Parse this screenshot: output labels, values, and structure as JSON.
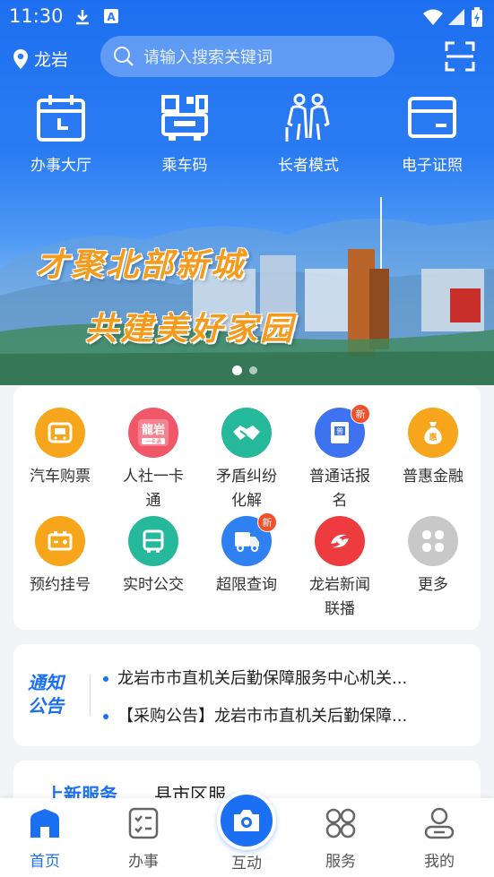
{
  "status_bar": {
    "time": "11:30"
  },
  "header": {
    "location": "龙岩",
    "search_placeholder": "请输入搜索关键词"
  },
  "quick_actions": [
    {
      "label": "办事大厅",
      "icon": "calendar-icon"
    },
    {
      "label": "乘车码",
      "icon": "bus-qr-icon"
    },
    {
      "label": "长者模式",
      "icon": "elderly-icon"
    },
    {
      "label": "电子证照",
      "icon": "card-icon"
    }
  ],
  "banner": {
    "line1": "才聚北部新城",
    "line2": "共建美好家园",
    "active_slide": 1,
    "slide_count": 2
  },
  "services": [
    {
      "label": "汽车购票",
      "color": "#f7a51a",
      "icon": "bus-ticket-icon"
    },
    {
      "label": "人社一卡通",
      "color": "#f0586a",
      "icon": "social-card-icon"
    },
    {
      "label": "矛盾纠纷化解",
      "color": "#25b89a",
      "icon": "handshake-icon"
    },
    {
      "label": "普通话报名",
      "color": "#3d73f0",
      "icon": "mandarin-book-icon",
      "badge": "新"
    },
    {
      "label": "普惠金融",
      "color": "#f7a51a",
      "icon": "money-bag-icon"
    },
    {
      "label": "预约挂号",
      "color": "#f7a51a",
      "icon": "battery-icon"
    },
    {
      "label": "实时公交",
      "color": "#25b89a",
      "icon": "bus-icon"
    },
    {
      "label": "超限查询",
      "color": "#2f80f0",
      "icon": "truck-icon",
      "badge": "新"
    },
    {
      "label": "龙岩新闻联播",
      "color": "#ee3b3f",
      "icon": "news-logo-icon"
    },
    {
      "label": "更多",
      "color": "#c8c8c8",
      "icon": "grid-icon"
    }
  ],
  "notice": {
    "logo_line1": "通知",
    "logo_line2": "公告",
    "items": [
      "龙岩市市直机关后勤保障服务中心机关...",
      "【采购公告】龙岩市市直机关后勤保障..."
    ]
  },
  "new_services": {
    "tab_active": "上新服务",
    "tab_other": "县市区服..."
  },
  "bottom_nav": [
    {
      "label": "首页",
      "icon": "home-icon",
      "active": true
    },
    {
      "label": "办事",
      "icon": "checklist-icon"
    },
    {
      "label": "互动",
      "icon": "camera-icon"
    },
    {
      "label": "服务",
      "icon": "services-grid-icon"
    },
    {
      "label": "我的",
      "icon": "profile-icon"
    }
  ],
  "colors": {
    "primary": "#1a6ff2",
    "badge": "#f0512d"
  }
}
